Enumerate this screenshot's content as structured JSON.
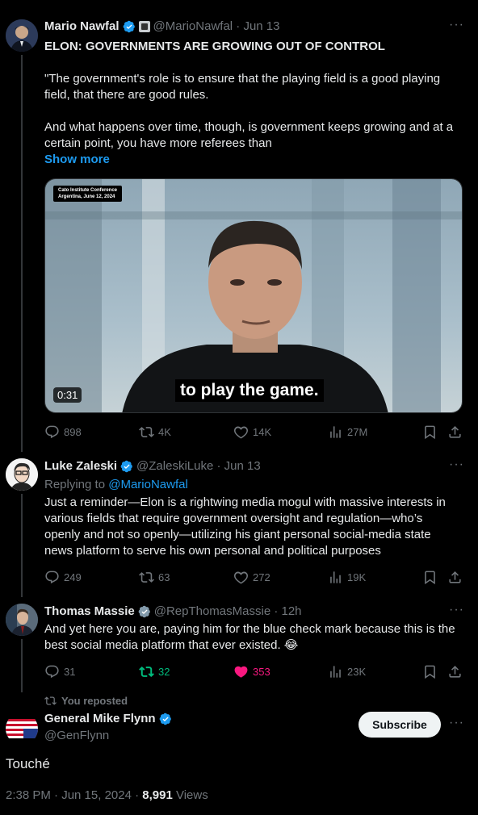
{
  "tweet1": {
    "name": "Mario Nawfal",
    "handle_time": "@MarioNawfal · Jun 13",
    "title": "ELON: GOVERNMENTS ARE GROWING OUT OF CONTROL",
    "para1": "\"The government's role is to ensure that the playing field is a good playing field, that there are good rules.",
    "para2": "And what happens over time, though, is government keeps growing and at a certain point, you have more referees than",
    "show_more": "Show more",
    "video": {
      "badge_line1": "Cato Institute Conference",
      "badge_line2": "Argentina, June 12, 2024",
      "caption": "to play the game.",
      "duration": "0:31"
    },
    "actions": {
      "replies": "898",
      "reposts": "4K",
      "likes": "14K",
      "views": "27M"
    }
  },
  "tweet2": {
    "name": "Luke Zaleski",
    "handle_time": "@ZaleskiLuke · Jun 13",
    "replying_prefix": "Replying to",
    "replying_handle": "@MarioNawfal",
    "body": "Just a reminder—Elon is a rightwing media mogul with massive interests in various fields that require government oversight and regulation—who’s openly and not so openly—utilizing his giant personal social-media state news platform to serve his own personal and political purposes",
    "actions": {
      "replies": "249",
      "reposts": "63",
      "likes": "272",
      "views": "19K"
    }
  },
  "tweet3": {
    "name": "Thomas Massie",
    "handle_time": "@RepThomasMassie · 12h",
    "body": "And yet here you are, paying him for the blue check mark because this is the best social media platform that ever existed. 😂",
    "actions": {
      "replies": "31",
      "reposts": "32",
      "likes": "353",
      "views": "23K"
    },
    "colors": {
      "repost_active": "#00ba7c",
      "like_active": "#f91880"
    }
  },
  "main": {
    "reposted_label": "You reposted",
    "name": "General Mike Flynn",
    "handle": "@GenFlynn",
    "subscribe": "Subscribe",
    "body": "Touché",
    "timestamp": "2:38 PM · Jun 15, 2024 · ",
    "views_count": "8,991",
    "views_label": " Views"
  },
  "colors": {
    "accent": "#1d9bf0",
    "muted": "#71767b",
    "text": "#e7e9ea",
    "bg": "#000000"
  }
}
